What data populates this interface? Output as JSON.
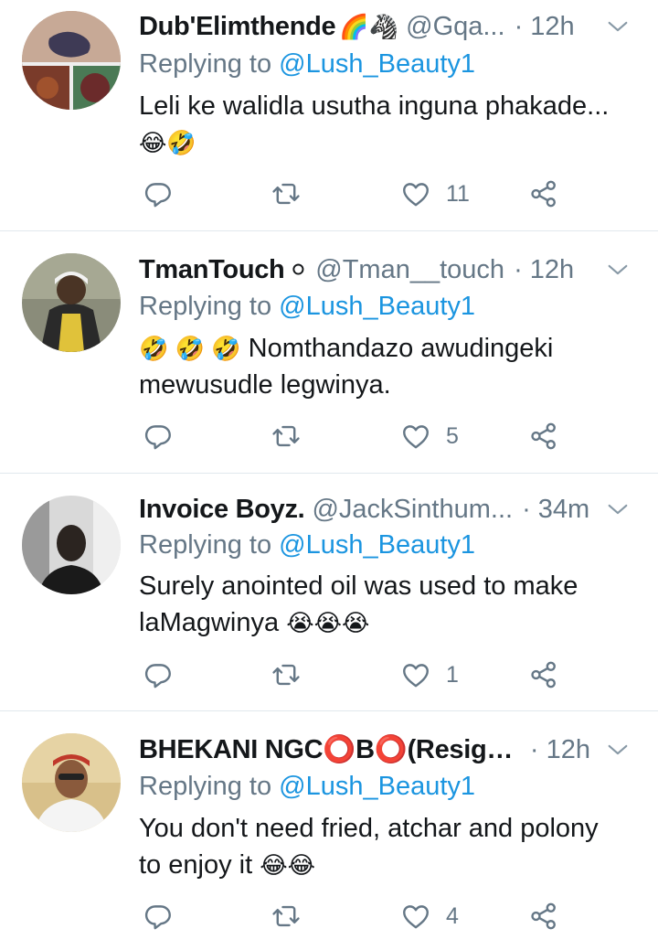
{
  "tweets": [
    {
      "name": "Dub'Elimthende",
      "badge": "🌈🦓",
      "handle": "@Gqa...",
      "time": "· 12h",
      "replying_prefix": "Replying to ",
      "replying_to": "@Lush_Beauty1",
      "text_line1": "Leli ke walidla usutha inguna phakade...",
      "text_line2": "😂🤣",
      "likes": "11"
    },
    {
      "name": "TmanTouch",
      "badge": "⚪",
      "handle": "@Tman__touch",
      "time": "· 12h",
      "replying_prefix": "Replying to ",
      "replying_to": "@Lush_Beauty1",
      "text_emoji": "🤣 🤣 🤣",
      "text_line1": " Nomthandazo awudingeki",
      "text_line2": "mewusudle legwinya.",
      "likes": "5"
    },
    {
      "name": "Invoice Boyz.",
      "handle": "@JackSinthum...",
      "time": "· 34m",
      "replying_prefix": "Replying to ",
      "replying_to": "@Lush_Beauty1",
      "text_line1": "Surely anointed oil was used to make",
      "text_line2": "laMagwinya ",
      "text_emoji": "😭😭😭",
      "likes": "1"
    },
    {
      "name": "BHEKANI NGC⭕B⭕(Resign...",
      "handle": "",
      "time": "· 12h",
      "replying_prefix": "Replying to ",
      "replying_to": "@Lush_Beauty1",
      "text_line1": "You don't need fried, atchar and polony",
      "text_line2": "to enjoy it ",
      "text_emoji": "😂😂",
      "likes": "4"
    }
  ],
  "icons": {
    "reply": "reply-icon",
    "retweet": "retweet-icon",
    "like": "heart-icon",
    "share": "share-icon",
    "more": "chevron-down-icon"
  },
  "colors": {
    "text": "#14171a",
    "secondary": "#657786",
    "link": "#1b95e0",
    "divider": "#e1e8ed"
  }
}
